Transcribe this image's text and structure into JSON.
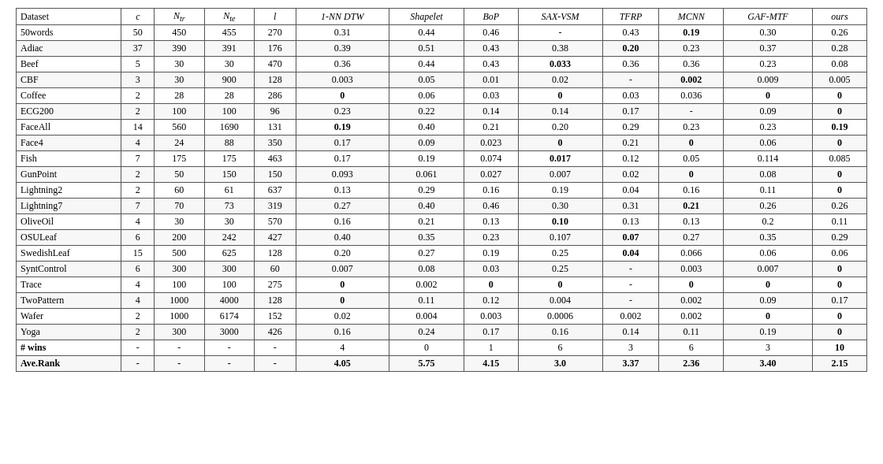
{
  "table": {
    "columns": [
      "Dataset",
      "c",
      "Ntr",
      "Nte",
      "l",
      "1-NN DTW",
      "Shapelet",
      "BoP",
      "SAX-VSM",
      "TFRP",
      "MCNN",
      "GAF-MTF",
      "ours"
    ],
    "col_styles": [
      "italic_col_c",
      "italic_col_ntr",
      "italic_col_nte",
      "italic_col_l"
    ],
    "rows": [
      [
        "50words",
        "50",
        "450",
        "455",
        "270",
        "0.31",
        "0.44",
        "0.46",
        "-",
        "0.43",
        {
          "v": "0.19",
          "b": true
        },
        "0.30",
        "0.26"
      ],
      [
        "Adiac",
        "37",
        "390",
        "391",
        "176",
        "0.39",
        "0.51",
        "0.43",
        "0.38",
        {
          "v": "0.20",
          "b": true
        },
        "0.23",
        "0.37",
        "0.28"
      ],
      [
        "Beef",
        "5",
        "30",
        "30",
        "470",
        "0.36",
        "0.44",
        "0.43",
        {
          "v": "0.033",
          "b": true
        },
        "0.36",
        "0.36",
        "0.23",
        "0.08"
      ],
      [
        "CBF",
        "3",
        "30",
        "900",
        "128",
        "0.003",
        "0.05",
        "0.01",
        "0.02",
        "-",
        {
          "v": "0.002",
          "b": true
        },
        "0.009",
        "0.005"
      ],
      [
        "Coffee",
        "2",
        "28",
        "28",
        "286",
        {
          "v": "0",
          "b": true
        },
        "0.06",
        "0.03",
        {
          "v": "0",
          "b": true
        },
        "0.03",
        "0.036",
        {
          "v": "0",
          "b": true
        },
        {
          "v": "0",
          "b": true
        }
      ],
      [
        "ECG200",
        "2",
        "100",
        "100",
        "96",
        "0.23",
        "0.22",
        "0.14",
        "0.14",
        "0.17",
        "-",
        "0.09",
        {
          "v": "0",
          "b": true
        }
      ],
      [
        "FaceAll",
        "14",
        "560",
        "1690",
        "131",
        {
          "v": "0.19",
          "b": true
        },
        "0.40",
        "0.21",
        "0.20",
        "0.29",
        "0.23",
        "0.23",
        {
          "v": "0.19",
          "b": true
        }
      ],
      [
        "Face4",
        "4",
        "24",
        "88",
        "350",
        "0.17",
        "0.09",
        "0.023",
        {
          "v": "0",
          "b": true
        },
        "0.21",
        {
          "v": "0",
          "b": true
        },
        "0.06",
        {
          "v": "0",
          "b": true
        }
      ],
      [
        "Fish",
        "7",
        "175",
        "175",
        "463",
        "0.17",
        "0.19",
        "0.074",
        {
          "v": "0.017",
          "b": true
        },
        "0.12",
        "0.05",
        "0.114",
        "0.085"
      ],
      [
        "GunPoint",
        "2",
        "50",
        "150",
        "150",
        "0.093",
        "0.061",
        "0.027",
        "0.007",
        "0.02",
        {
          "v": "0",
          "b": true
        },
        "0.08",
        {
          "v": "0",
          "b": true
        }
      ],
      [
        "Lightning2",
        "2",
        "60",
        "61",
        "637",
        "0.13",
        "0.29",
        "0.16",
        "0.19",
        "0.04",
        "0.16",
        "0.11",
        {
          "v": "0",
          "b": true
        }
      ],
      [
        "Lightning7",
        "7",
        "70",
        "73",
        "319",
        "0.27",
        "0.40",
        "0.46",
        "0.30",
        "0.31",
        {
          "v": "0.21",
          "b": true
        },
        "0.26",
        "0.26"
      ],
      [
        "OliveOil",
        "4",
        "30",
        "30",
        "570",
        "0.16",
        "0.21",
        "0.13",
        {
          "v": "0.10",
          "b": true
        },
        "0.13",
        "0.13",
        "0.2",
        "0.11"
      ],
      [
        "OSULeaf",
        "6",
        "200",
        "242",
        "427",
        "0.40",
        "0.35",
        "0.23",
        "0.107",
        {
          "v": "0.07",
          "b": true
        },
        "0.27",
        "0.35",
        "0.29"
      ],
      [
        "SwedishLeaf",
        "15",
        "500",
        "625",
        "128",
        "0.20",
        "0.27",
        "0.19",
        "0.25",
        {
          "v": "0.04",
          "b": true
        },
        "0.066",
        "0.06",
        "0.06"
      ],
      [
        "SyntControl",
        "6",
        "300",
        "300",
        "60",
        "0.007",
        "0.08",
        "0.03",
        "0.25",
        "-",
        "0.003",
        "0.007",
        {
          "v": "0",
          "b": true
        }
      ],
      [
        "Trace",
        "4",
        "100",
        "100",
        "275",
        {
          "v": "0",
          "b": true
        },
        "0.002",
        {
          "v": "0",
          "b": true
        },
        {
          "v": "0",
          "b": true
        },
        "-",
        {
          "v": "0",
          "b": true
        },
        {
          "v": "0",
          "b": true
        },
        {
          "v": "0",
          "b": true
        }
      ],
      [
        "TwoPattern",
        "4",
        "1000",
        "4000",
        "128",
        {
          "v": "0",
          "b": true
        },
        "0.11",
        "0.12",
        "0.004",
        "-",
        "0.002",
        "0.09",
        "0.17"
      ],
      [
        "Wafer",
        "2",
        "1000",
        "6174",
        "152",
        "0.02",
        "0.004",
        "0.003",
        "0.0006",
        "0.002",
        "0.002",
        {
          "v": "0",
          "b": true
        },
        {
          "v": "0",
          "b": true
        }
      ],
      [
        "Yoga",
        "2",
        "300",
        "3000",
        "426",
        "0.16",
        "0.24",
        "0.17",
        "0.16",
        "0.14",
        "0.11",
        "0.19",
        {
          "v": "0",
          "b": true
        }
      ]
    ],
    "wins_row": [
      "# wins",
      "-",
      "-",
      "-",
      "-",
      "4",
      "0",
      "1",
      "6",
      "3",
      "6",
      "3",
      {
        "v": "10",
        "b": true
      }
    ],
    "rank_row": [
      "Ave.Rank",
      "-",
      "-",
      "-",
      "-",
      "4.05",
      "5.75",
      "4.15",
      "3.0",
      "3.37",
      "2.36",
      "3.40",
      {
        "v": "2.15",
        "b": true
      }
    ]
  }
}
